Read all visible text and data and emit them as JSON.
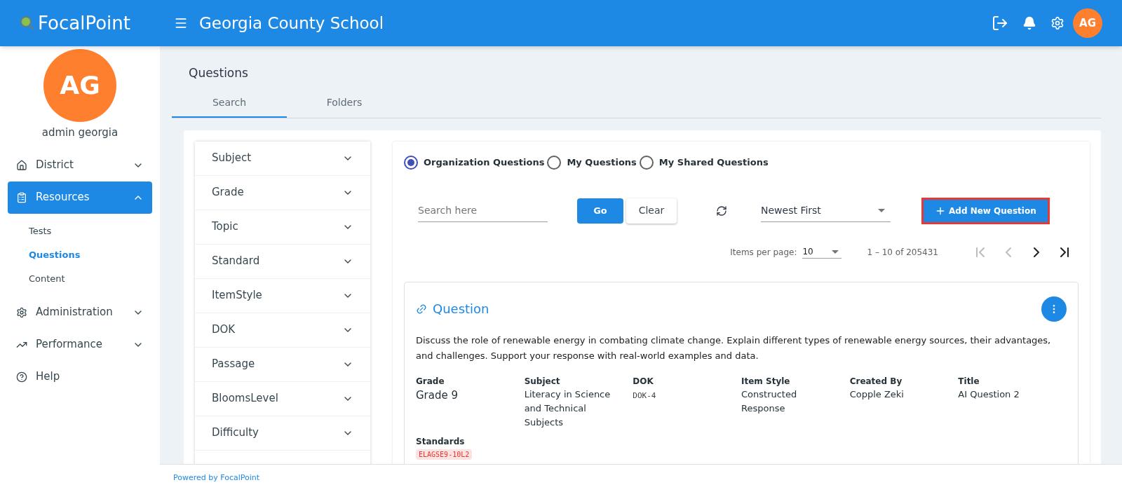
{
  "header": {
    "logo_text": "FocalPoint",
    "title": "Georgia County School",
    "avatar": "AG"
  },
  "sidebar": {
    "avatar": "AG",
    "user_name": "admin georgia",
    "items": [
      {
        "label": "District",
        "kind": "group",
        "expanded": false,
        "selected": false
      },
      {
        "label": "Resources",
        "kind": "group",
        "expanded": true,
        "selected": true,
        "children": [
          {
            "label": "Tests",
            "selected": false
          },
          {
            "label": "Questions",
            "selected": true
          },
          {
            "label": "Content",
            "selected": false
          }
        ]
      },
      {
        "label": "Administration",
        "kind": "group",
        "expanded": false,
        "selected": false
      },
      {
        "label": "Performance",
        "kind": "group",
        "expanded": false,
        "selected": false
      },
      {
        "label": "Help",
        "kind": "link",
        "selected": false
      }
    ]
  },
  "page_title": "Questions",
  "tabs": [
    {
      "label": "Search",
      "selected": true
    },
    {
      "label": "Folders",
      "selected": false
    }
  ],
  "filters": [
    "Subject",
    "Grade",
    "Topic",
    "Standard",
    "ItemStyle",
    "DOK",
    "Passage",
    "BloomsLevel",
    "Difficulty"
  ],
  "scope_options": [
    {
      "label": "Organization Questions",
      "selected": true
    },
    {
      "label": "My Questions",
      "selected": false
    },
    {
      "label": "My Shared Questions",
      "selected": false
    }
  ],
  "search": {
    "placeholder": "Search here",
    "go": "Go",
    "clear": "Clear"
  },
  "sort": {
    "value": "Newest First"
  },
  "add_button": {
    "label": "Add New Question",
    "highlighted": true
  },
  "pagination": {
    "items_per_page_label": "Items per page:",
    "items_per_page": "10",
    "range": "1 – 10 of 205431"
  },
  "question": {
    "title": "Question",
    "text": "Discuss the role of renewable energy in combating climate change. Explain different types of renewable energy sources, their advantages, and challenges. Support your response with real-world examples and data.",
    "fields": [
      {
        "label": "Grade",
        "value": "Grade 9",
        "kind": "large"
      },
      {
        "label": "Subject",
        "value": "Literacy in Science and Technical Subjects",
        "kind": "text"
      },
      {
        "label": "DOK",
        "value": "DOK-4",
        "kind": "code"
      },
      {
        "label": "Item Style",
        "value": "Constructed Response",
        "kind": "text"
      },
      {
        "label": "Created By",
        "value": "Copple Zeki",
        "kind": "text"
      },
      {
        "label": "Title",
        "value": "AI Question 2",
        "kind": "text"
      }
    ],
    "standards_label": "Standards",
    "standards": [
      "ELAGSE9-10L2"
    ]
  },
  "footer": {
    "text": "Powered by FocalPoint"
  }
}
